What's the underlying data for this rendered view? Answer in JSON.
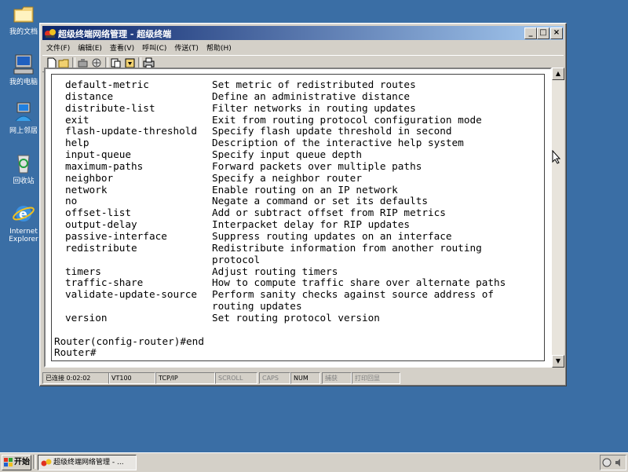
{
  "desktop": {
    "icons": [
      {
        "label": "我的文档",
        "icon": "folder-icon"
      },
      {
        "label": "我的电脑",
        "icon": "computer-icon"
      },
      {
        "label": "网上邻居",
        "icon": "network-icon"
      },
      {
        "label": "回收站",
        "icon": "recycle-bin-icon"
      },
      {
        "label": "Internet Explorer",
        "icon": "ie-icon"
      }
    ]
  },
  "window": {
    "title": "超级终端网络管理 - 超级终端",
    "menu": [
      "文件(F)",
      "编辑(E)",
      "查看(V)",
      "呼叫(C)",
      "传送(T)",
      "帮助(H)"
    ],
    "toolbar": [
      "new-icon",
      "open-icon",
      "disconnect-icon",
      "properties-icon",
      "send-icon",
      "receive-icon",
      "print-icon"
    ]
  },
  "terminal": {
    "rows": [
      {
        "cmd": "default-metric",
        "desc": "Set metric of redistributed routes"
      },
      {
        "cmd": "distance",
        "desc": "Define an administrative distance"
      },
      {
        "cmd": "distribute-list",
        "desc": "Filter networks in routing updates"
      },
      {
        "cmd": "exit",
        "desc": "Exit from routing protocol configuration mode"
      },
      {
        "cmd": "flash-update-threshold",
        "desc": "Specify flash update threshold in second"
      },
      {
        "cmd": "help",
        "desc": "Description of the interactive help system"
      },
      {
        "cmd": "input-queue",
        "desc": "Specify input queue depth"
      },
      {
        "cmd": "maximum-paths",
        "desc": "Forward packets over multiple paths"
      },
      {
        "cmd": "neighbor",
        "desc": "Specify a neighbor router"
      },
      {
        "cmd": "network",
        "desc": "Enable routing on an IP network"
      },
      {
        "cmd": "no",
        "desc": "Negate a command or set its defaults"
      },
      {
        "cmd": "offset-list",
        "desc": "Add or subtract offset from RIP metrics"
      },
      {
        "cmd": "output-delay",
        "desc": "Interpacket delay for RIP updates"
      },
      {
        "cmd": "passive-interface",
        "desc": "Suppress routing updates on an interface"
      },
      {
        "cmd": "redistribute",
        "desc": "Redistribute information from another routing"
      },
      {
        "cmd": "",
        "desc": "protocol"
      },
      {
        "cmd": "timers",
        "desc": "Adjust routing timers"
      },
      {
        "cmd": "traffic-share",
        "desc": "How to compute traffic share over alternate paths"
      },
      {
        "cmd": "validate-update-source",
        "desc": "Perform sanity checks against source address of"
      },
      {
        "cmd": "",
        "desc": "routing updates"
      },
      {
        "cmd": "version",
        "desc": "Set routing protocol version"
      }
    ],
    "blank": "",
    "line_end": "Router(config-router)#end",
    "line_prompt": "Router#"
  },
  "status": {
    "connected": "已连接 0:02:02",
    "emulation": "VT100",
    "protocol": "TCP/IP",
    "scroll": "SCROLL",
    "caps": "CAPS",
    "num": "NUM",
    "capture": "捕获",
    "print_echo": "打印回显"
  },
  "taskbar": {
    "start": "开始",
    "task": "超级终端网络管理 - ..."
  }
}
